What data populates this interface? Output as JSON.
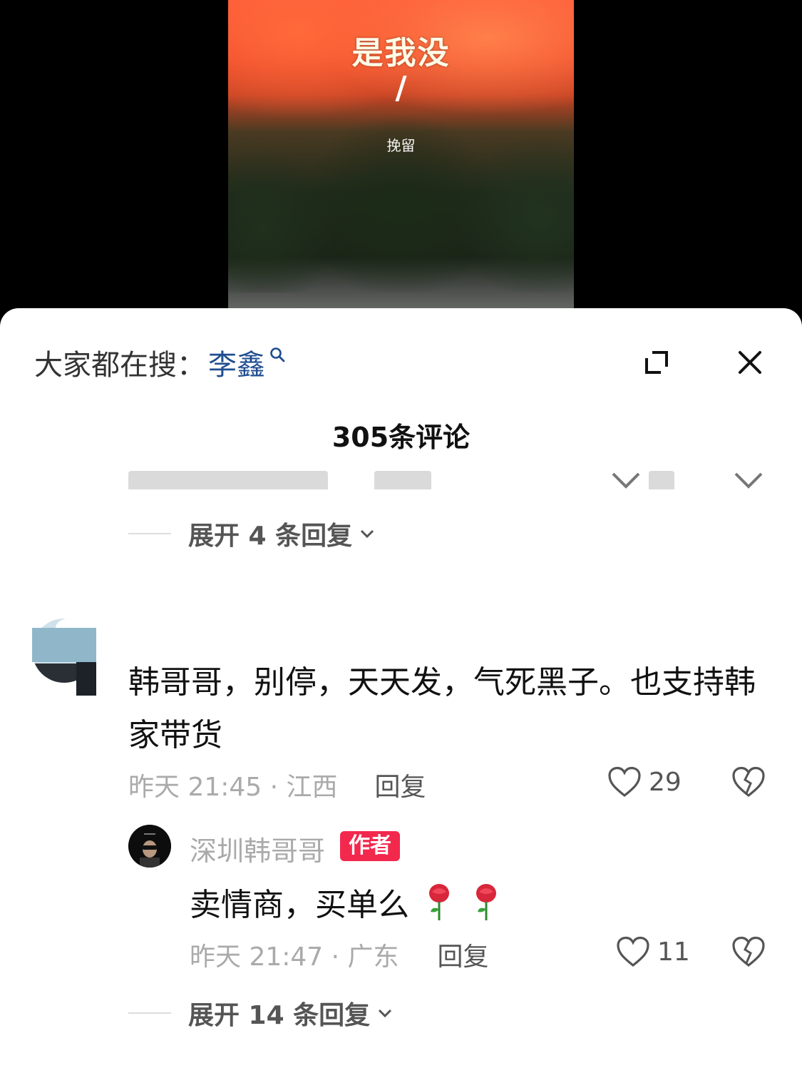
{
  "video": {
    "title": "是我没",
    "slash": "/",
    "caption": "挽留"
  },
  "search": {
    "prefix": "大家都在搜：",
    "term": "李鑫"
  },
  "header": {
    "comment_count": "305条评论"
  },
  "partial_comment": {
    "expand_label": "展开 4 条回复"
  },
  "comment": {
    "text": "韩哥哥，别停，天天发，气死黑子。也支持韩家带货",
    "time_location": "昨天 21:45 · 江西",
    "reply_label": "回复",
    "like_count": "29",
    "reply": {
      "author": "深圳韩哥哥",
      "badge": "作者",
      "text": "卖情商，买单么",
      "time_location": "昨天 21:47 · 广东",
      "reply_label": "回复",
      "like_count": "11"
    },
    "expand_label": "展开 14 条回复"
  },
  "colors": {
    "accent_link": "#1f4d8f",
    "badge_red": "#f3284d"
  }
}
